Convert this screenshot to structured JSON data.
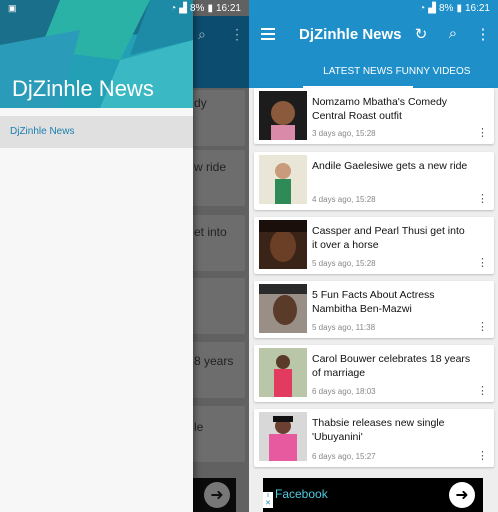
{
  "status": {
    "battery": "8%",
    "time": "16:21"
  },
  "drawer": {
    "title": "DjZinhle News",
    "item": "DjZinhle News"
  },
  "dimmed_fragments": [
    "dy",
    "w ride",
    "et into",
    "8 years",
    "le"
  ],
  "app": {
    "title": "DjZinhle News",
    "tabs": [
      "LATEST NEWS",
      "FUNNY VIDEOS"
    ]
  },
  "articles": [
    {
      "title": "Nomzamo Mbatha's Comedy Central Roast outfit",
      "time": "3 days ago, 15:28"
    },
    {
      "title": "Andile Gaelesiwe gets a new ride",
      "time": "4 days ago, 15:28"
    },
    {
      "title": "Cassper and Pearl Thusi get into it over a horse",
      "time": "5 days ago, 15:28"
    },
    {
      "title": "5 Fun Facts About Actress Nambitha Ben-Mazwi",
      "time": "5 days ago, 11:38"
    },
    {
      "title": "Carol Bouwer celebrates 18 years of marriage",
      "time": "6 days ago, 18:03"
    },
    {
      "title": "Thabsie releases new single 'Ubuyanini'",
      "time": "6 days ago, 15:27"
    }
  ],
  "ad": {
    "label": "Facebook"
  },
  "colors": {
    "primary": "#1e8fc9",
    "accent": "#23a0b5"
  }
}
